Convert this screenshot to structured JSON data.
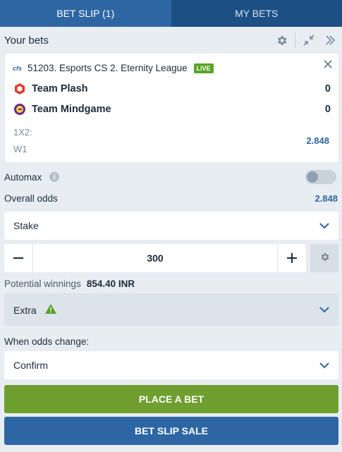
{
  "tabs": [
    {
      "label": "BET SLIP (1)",
      "active": true
    },
    {
      "label": "MY BETS",
      "active": false
    }
  ],
  "header": {
    "title": "Your bets"
  },
  "bet": {
    "league_logo": "cfs",
    "league": "51203. Esports CS 2. Eternity League",
    "live_badge": "LIVE",
    "teams": [
      {
        "name": "Team Plash",
        "score": "0"
      },
      {
        "name": "Team Mindgame",
        "score": "0"
      }
    ],
    "market": "1X2:",
    "selection": "W1",
    "odds": "2.848"
  },
  "automax": {
    "label": "Automax",
    "enabled": false
  },
  "overall": {
    "label": "Overall odds",
    "value": "2.848"
  },
  "stake": {
    "label": "Stake",
    "amount": "300"
  },
  "potential": {
    "label": "Potential winnings",
    "value": "854.40 INR"
  },
  "extra": {
    "label": "Extra"
  },
  "odds_change": {
    "label": "When odds change:",
    "selected": "Confirm"
  },
  "buttons": {
    "place": "PLACE A BET",
    "sale": "BET SLIP SALE"
  },
  "colors": {
    "primary": "#2e66a3",
    "tab_inactive": "#1c4f84",
    "place": "#6e9f2f",
    "live": "#5aa326",
    "warning": "#5aa326"
  }
}
